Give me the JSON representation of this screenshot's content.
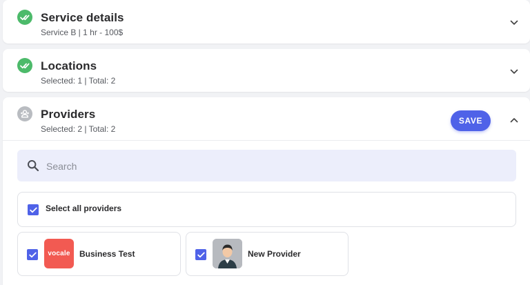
{
  "steps": [
    {
      "title": "Service details",
      "subtitle": "Service B | 1 hr - 100$",
      "status": "done",
      "expanded": false
    },
    {
      "title": "Locations",
      "subtitle": "Selected: 1 | Total: 2",
      "status": "done",
      "expanded": false
    },
    {
      "title": "Providers",
      "subtitle": "Selected: 2 | Total: 2",
      "status": "pending",
      "expanded": true
    }
  ],
  "providers_panel": {
    "save_label": "SAVE",
    "search_placeholder": "Search",
    "select_all_label": "Select all providers",
    "select_all_checked": true,
    "items": [
      {
        "name": "Business Test",
        "checked": true,
        "avatar": "vocale-logo",
        "logo_text": "vocale"
      },
      {
        "name": "New Provider",
        "checked": true,
        "avatar": "person-avatar"
      }
    ]
  },
  "colors": {
    "accent": "#4f62e8",
    "done_green": "#4cba6a",
    "pending_gray": "#b9bcc1",
    "search_bg": "#eceefb",
    "logo_red": "#f25a52"
  },
  "icons": {
    "done": "double-check-icon",
    "pending": "users-icon",
    "collapsed": "chevron-down-icon",
    "expanded": "chevron-up-icon",
    "search": "search-icon",
    "checkbox": "checkbox-checked-icon"
  }
}
